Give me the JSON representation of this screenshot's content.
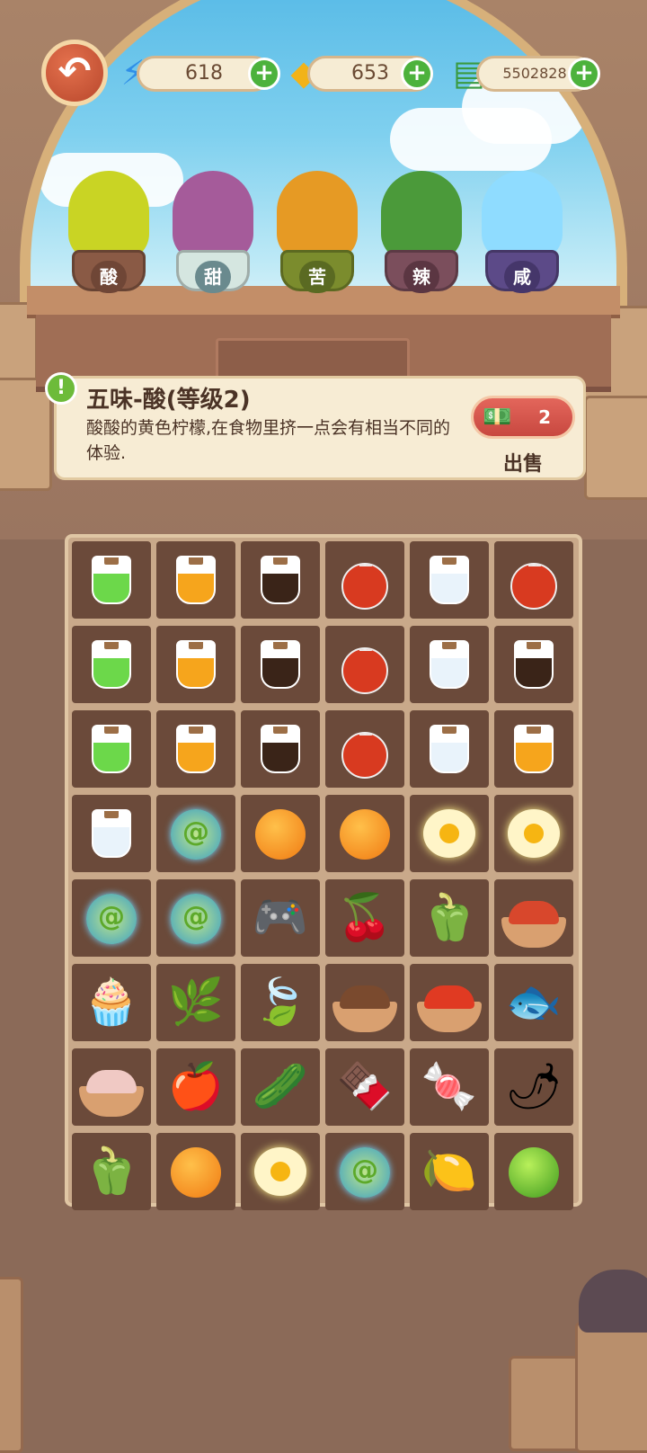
{
  "top_bar": {
    "energy": "618",
    "gems": "653",
    "cash": "5502828",
    "plus": "+",
    "back_glyph": "↶"
  },
  "plants": [
    {
      "label": "酸",
      "foliage": "#c9d424",
      "pot": "#8a5a45",
      "tag": "#6f4636"
    },
    {
      "label": "甜",
      "foliage": "#a55b9a",
      "pot": "#d5e6e0",
      "tag": "#6a8a8e"
    },
    {
      "label": "苦",
      "foliage": "#e69a24",
      "pot": "#7b8c2d",
      "tag": "#5a6a22"
    },
    {
      "label": "辣",
      "foliage": "#4b9a3a",
      "pot": "#7b4e5c",
      "tag": "#5b3642"
    },
    {
      "label": "咸",
      "foliage": "#8fdcff",
      "pot": "#5c4a88",
      "tag": "#45366a"
    }
  ],
  "info": {
    "excl": "!",
    "title": "五味-酸(等级2)",
    "description": "酸酸的黄色柠檬,在食物里挤一点会有相当不同的体验.",
    "sell_value": "2",
    "sell_label": "出售"
  },
  "board": {
    "rows": [
      [
        "flask-green",
        "jar-orange",
        "bottle-soy",
        "bottle-red",
        "jar-salt",
        "bottle-red"
      ],
      [
        "flask-green",
        "jar-orange",
        "bottle-soy",
        "bottle-red",
        "jar-salt",
        "bottle-soy"
      ],
      [
        "flask-green",
        "jar-orange",
        "bottle-soy",
        "bottle-red",
        "jar-salt",
        "jar-orange"
      ],
      [
        "jar-salt",
        "swirl-orb",
        "orange-orb",
        "orange-orb",
        "egg-orb",
        "egg-orb"
      ],
      [
        "swirl-orb",
        "swirl-orb",
        "game-console",
        "lychee",
        "yellow-pepper",
        "chili-powder-bowl"
      ],
      [
        "cream-puff",
        "tamarind",
        "herb-leaves",
        "spice-bowl",
        "red-chili-bowl",
        "smoked-fish"
      ],
      [
        "salt-bowl",
        "hawthorn",
        "green-pepper",
        "brown-sugar",
        "candy",
        "red-chili"
      ],
      [
        "yellow-pepper",
        "orange-orb",
        "egg-orb",
        "swirl-orb",
        "lemon",
        "lime"
      ]
    ]
  }
}
